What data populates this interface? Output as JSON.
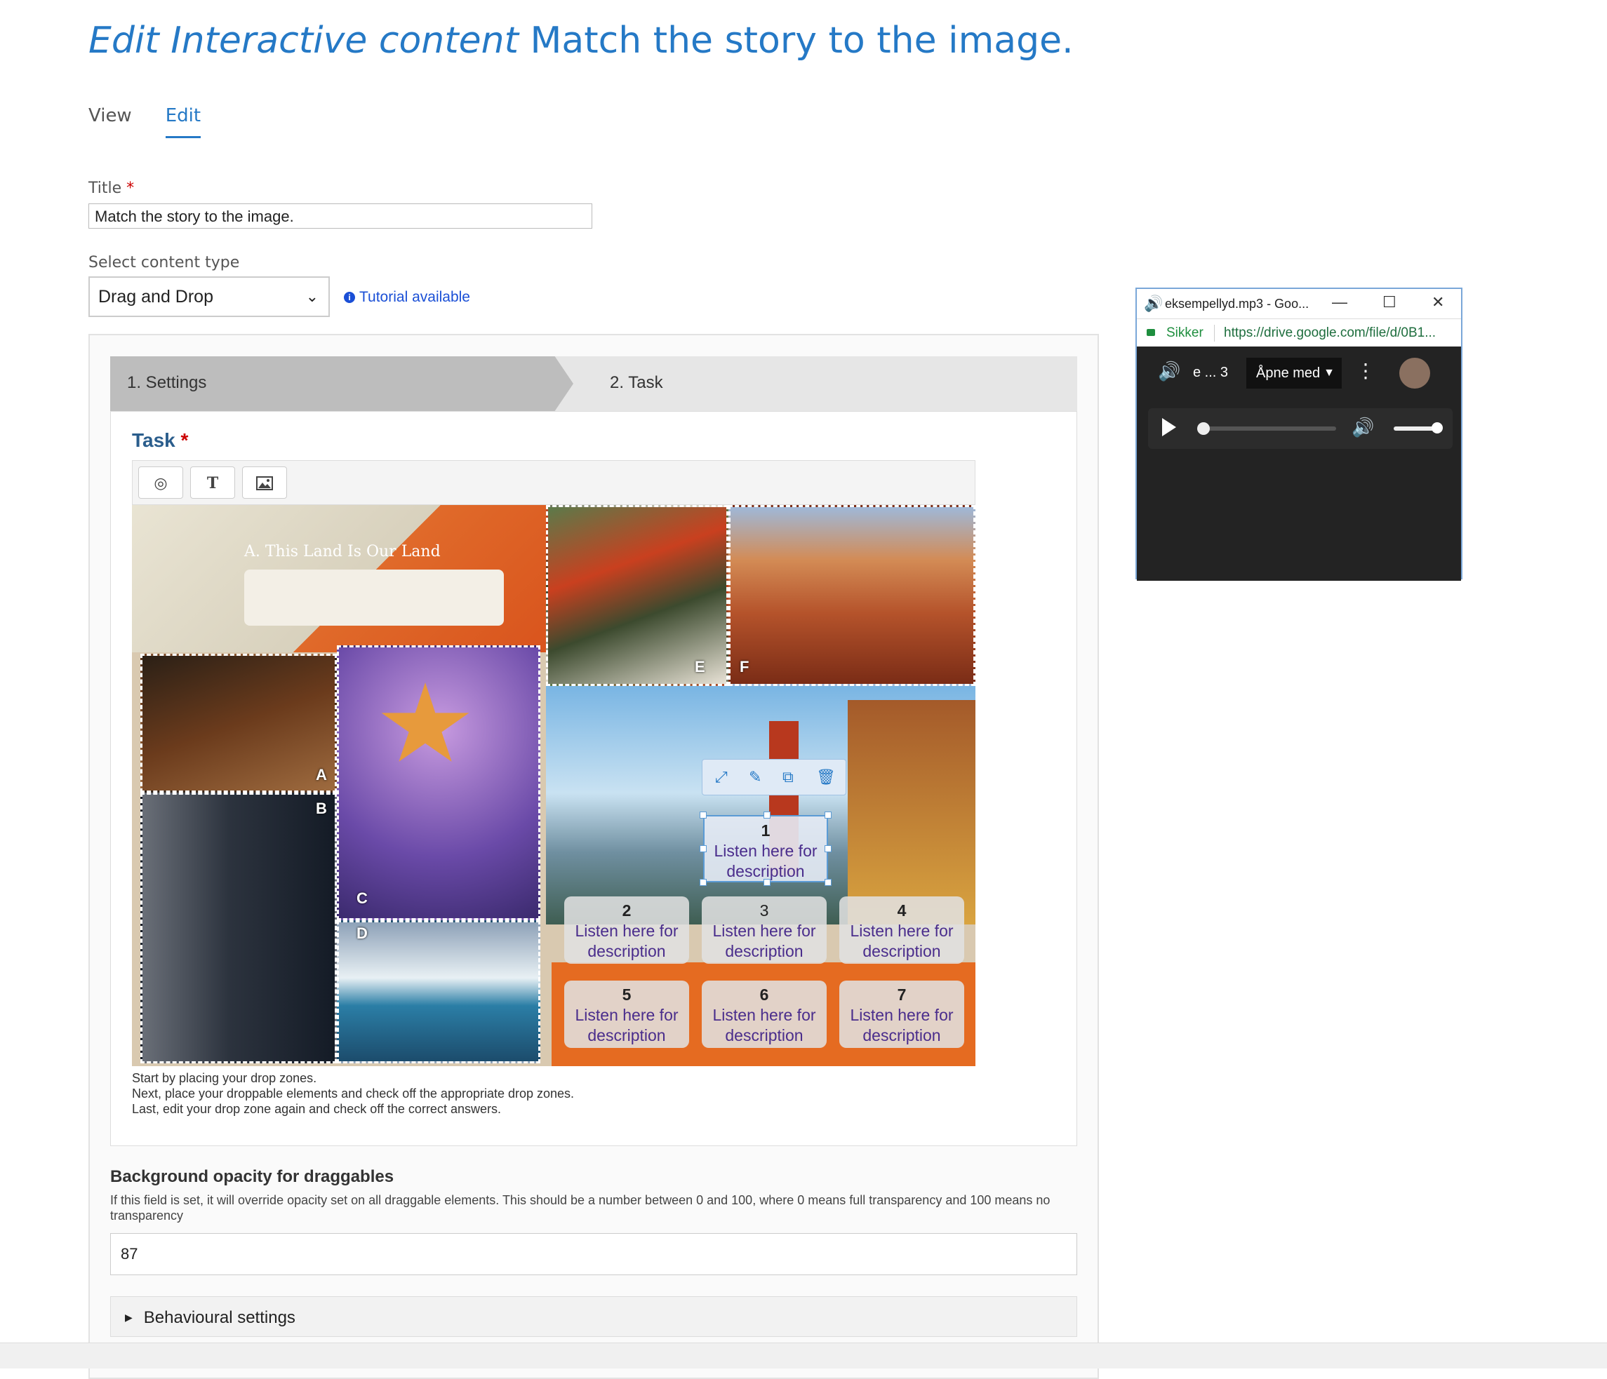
{
  "header": {
    "title_prefix": "Edit Interactive content",
    "title_name": "Match the story to the image.",
    "tabs": [
      {
        "label": "View"
      },
      {
        "label": "Edit"
      }
    ]
  },
  "form": {
    "title_label": "Title",
    "required_mark": "*",
    "title_value": "Match the story to the image.",
    "content_type_label": "Select content type",
    "content_type_value": "Drag and Drop",
    "tutorial_link": "Tutorial available"
  },
  "wizard": {
    "steps": [
      {
        "label": "1.  Settings"
      },
      {
        "label": "2.  Task"
      }
    ]
  },
  "task": {
    "label": "Task",
    "toolbar": [
      {
        "icon": "dropzone-icon"
      },
      {
        "icon": "text-icon",
        "glyph": "T"
      },
      {
        "icon": "image-icon"
      }
    ],
    "photo_letters": [
      "A",
      "B",
      "C",
      "D",
      "E",
      "F"
    ],
    "book_heading": "A. This Land Is Our Land",
    "dropzones": [
      {
        "number": "1",
        "label": "Listen here for description"
      },
      {
        "number": "2",
        "label": "Listen here for description"
      },
      {
        "number": "3",
        "label": "Listen here for description"
      },
      {
        "number": "4",
        "label": "Listen here for description"
      },
      {
        "number": "5",
        "label": "Listen here for description"
      },
      {
        "number": "6",
        "label": "Listen here for description"
      },
      {
        "number": "7",
        "label": "Listen here for description"
      }
    ],
    "hints": [
      "Start by placing your drop zones.",
      "Next, place your droppable elements and check off the appropriate drop zones.",
      "Last, edit your drop zone again and check off the correct answers."
    ]
  },
  "opacity": {
    "label": "Background opacity for draggables",
    "description": "If this field is set, it will override opacity set on all draggable elements. This should be a number between 0 and 100, where 0 means full transparency and 100 means no transparency",
    "value": "87"
  },
  "behavioural": {
    "label": "Behavioural settings"
  },
  "player_window": {
    "title": "eksempellyd.mp3 - Goo...",
    "secure_label": "Sikker",
    "url": "https://drive.google.com/file/d/0B1...",
    "file_short": "e ... 3",
    "open_with": "Åpne med"
  },
  "colors": {
    "accent": "#2579c6",
    "dropzone_text": "#4a2d8c",
    "secure": "#1e8e3e"
  }
}
